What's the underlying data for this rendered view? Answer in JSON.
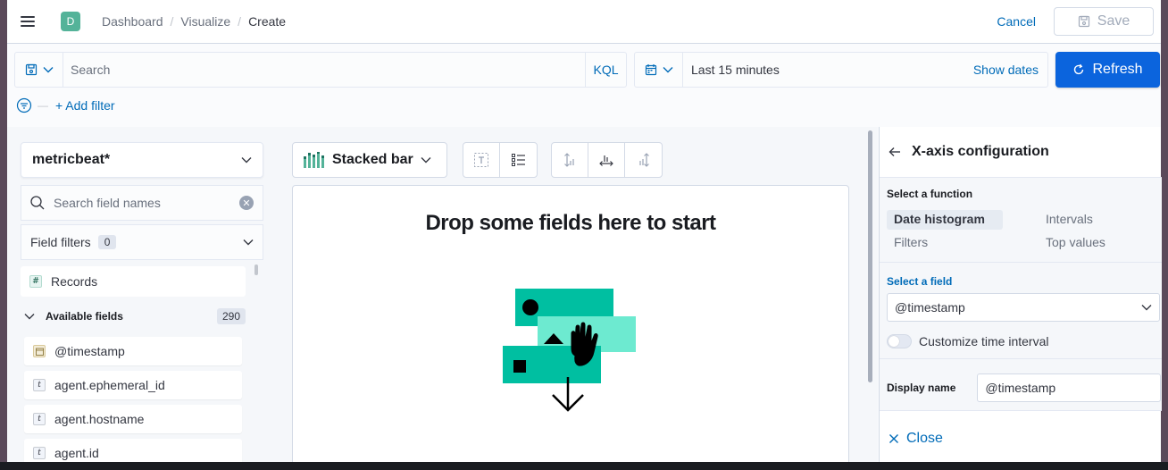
{
  "header": {
    "space_initial": "D",
    "breadcrumbs": [
      "Dashboard",
      "Visualize",
      "Create"
    ],
    "cancel_label": "Cancel",
    "save_label": "Save"
  },
  "query": {
    "search_placeholder": "Search",
    "language_label": "KQL",
    "time_range": "Last 15 minutes",
    "show_dates_label": "Show dates",
    "refresh_label": "Refresh",
    "add_filter_label": "+ Add filter"
  },
  "sidebar": {
    "index_pattern": "metricbeat*",
    "field_search_placeholder": "Search field names",
    "field_filters_label": "Field filters",
    "field_filters_count": "0",
    "records_label": "Records",
    "available_label": "Available fields",
    "available_count": "290",
    "fields": [
      {
        "name": "@timestamp",
        "type": "date"
      },
      {
        "name": "agent.ephemeral_id",
        "type": "t"
      },
      {
        "name": "agent.hostname",
        "type": "t"
      },
      {
        "name": "agent.id",
        "type": "t"
      }
    ]
  },
  "workspace": {
    "chart_type": "Stacked bar",
    "drop_message": "Drop some fields here to start"
  },
  "config_panel": {
    "title": "X-axis configuration",
    "function_label": "Select a function",
    "functions": [
      "Date histogram",
      "Intervals",
      "Filters",
      "Top values"
    ],
    "selected_function": "Date histogram",
    "field_label": "Select a field",
    "selected_field": "@timestamp",
    "custom_interval_label": "Customize time interval",
    "custom_interval_enabled": false,
    "display_name_label": "Display name",
    "display_name_value": "@timestamp",
    "close_label": "Close"
  },
  "colors": {
    "accent": "#0b64dd",
    "link": "#006bb8",
    "teal": "#00bfa1",
    "teal_light": "#6dead0"
  }
}
